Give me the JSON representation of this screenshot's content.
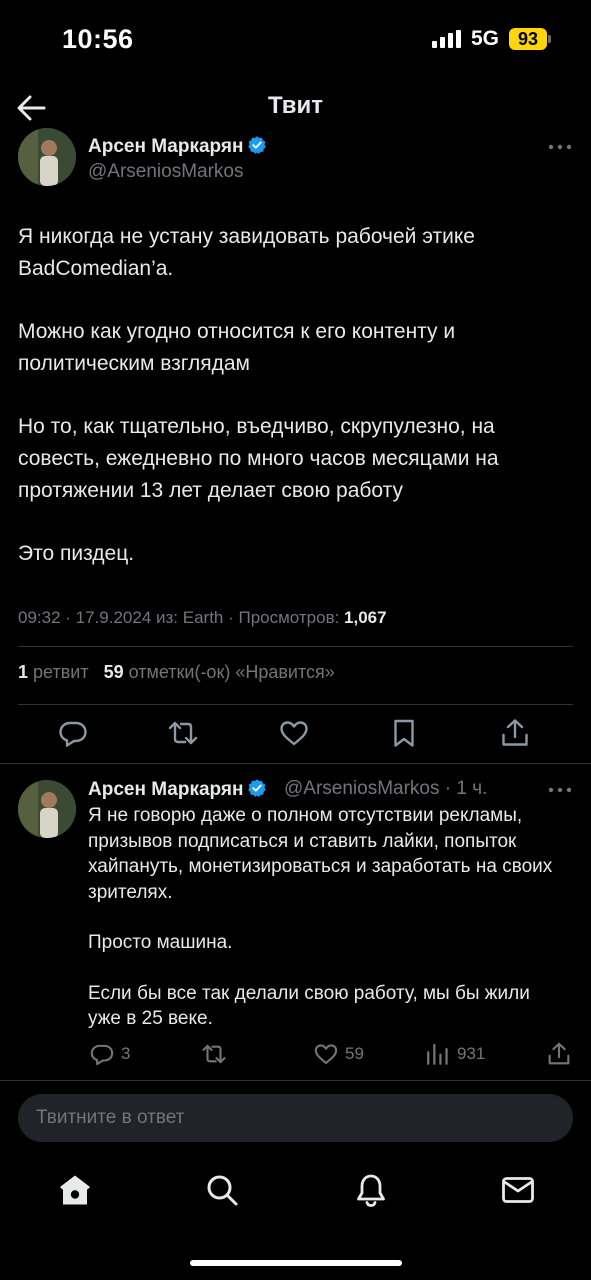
{
  "status_bar": {
    "time": "10:56",
    "network": "5G",
    "battery": "93"
  },
  "header": {
    "title": "Твит"
  },
  "tweet": {
    "author_name": "Арсен Маркарян",
    "author_handle": "@ArseniosMarkos",
    "paragraphs": [
      "Я никогда не устану завидовать рабочей этике BadComedian’a.",
      "Можно как угодно относится к его контенту и политическим взглядам",
      "Но то, как тщательно, въедчиво, скрупулезно, на совесть, ежедневно по много часов месяцами на протяжении 13 лет делает свою работу",
      "Это пиздец."
    ],
    "meta_prefix": "09:32 · 17.9.2024 из: Earth · Просмотров: ",
    "views": "1,067",
    "retweets_count": "1",
    "retweets_label": "ретвит",
    "likes_count": "59",
    "likes_label": "отметки(-ок) «Нравится»"
  },
  "reply": {
    "author_name": "Арсен Маркарян",
    "author_handle": "@ArseniosMarkos · 1 ч.",
    "paragraphs": [
      "Я не говорю даже о полном отсутствии рекламы, призывов подписаться и ставить лайки, попыток хайпануть, монетизироваться и заработать на своих зрителях.",
      "Просто машина.",
      "Если бы все так делали свою работу, мы бы жили уже в 25 веке."
    ],
    "reply_count": "3",
    "like_count": "59",
    "view_count": "931"
  },
  "compose": {
    "placeholder": "Твитните в ответ"
  },
  "tabs": [
    "home-icon",
    "search-icon",
    "bell-icon",
    "mail-icon"
  ],
  "colors": {
    "background": "#000000",
    "text": "#e7e9ea",
    "secondary": "#71767b",
    "verified": "#1d9bf0",
    "battery": "#ffd60a",
    "divider": "#2f3336"
  }
}
